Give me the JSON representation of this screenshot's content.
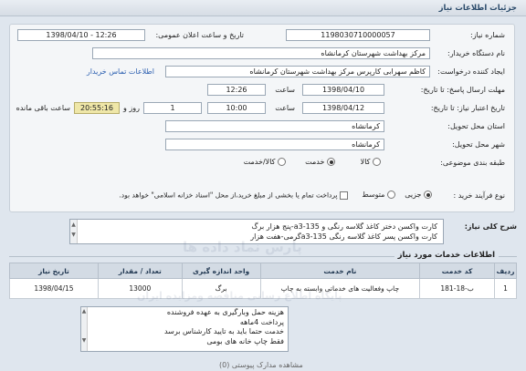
{
  "header": {
    "title": "جزئیات اطلاعات نیاز"
  },
  "form": {
    "need_number_label": "شماره نیاز:",
    "need_number": "1198030710000057",
    "announce_label": "تاریخ و ساعت اعلان عمومی:",
    "announce_value": "1398/04/10 - 12:26",
    "buyer_org_label": "نام دستگاه خریدار:",
    "buyer_org": "مرکز بهداشت شهرستان کرمانشاه",
    "creator_label": "ایجاد کننده درخواست:",
    "creator": "کاظم  سهرابی کارپرس مرکز بهداشت شهرستان کرمانشاه",
    "contact_link": "اطلاعات تماس خریدار",
    "deadline_label": "مهلت ارسال پاسخ: تا تاریخ:",
    "deadline_date": "1398/04/10",
    "deadline_time_label": "ساعت",
    "deadline_time": "12:26",
    "validity_label": "تاریخ اعتبار نیاز: تا تاریخ:",
    "validity_date": "1398/04/12",
    "validity_time_label": "ساعت",
    "validity_time": "10:00",
    "days_value": "1",
    "days_label": "روز و",
    "timer_value": "20:55:16",
    "remaining_label": "ساعت باقی مانده",
    "province_label": "استان محل تحویل:",
    "province": "کرمانشاه",
    "city_label": "شهر محل تحویل:",
    "city": "کرمانشاه",
    "category_label": "طبقه بندی موضوعی:",
    "category_options": [
      "کالا",
      "خدمت",
      "کالا/خدمت"
    ],
    "category_selected": "خدمت",
    "process_label": "نوع فرآیند خرید :",
    "process_options": [
      "جزیی",
      "متوسط"
    ],
    "process_selected": "جزیی",
    "payment_note": "پرداخت تمام یا بخشی از مبلغ خرید،از محل \"اسناد خزانه اسلامی\" خواهد بود."
  },
  "description": {
    "label": "شرح کلی نیاز:",
    "lines": [
      "کارت واکسن دختر کاغذ گلاسه  رنگی و 135-a3-پنج هزار برگ",
      "کارت واکسن پسر کاغذ گلاسه  رنگی a3-135گرمی-هفت هزار"
    ]
  },
  "services": {
    "section_title": "اطلاعات خدمات مورد نیاز",
    "columns": [
      "ردیف",
      "کد خدمت",
      "نام خدمت",
      "واحد اندازه گیری",
      "تعداد / مقدار",
      "تاریخ نیاز"
    ],
    "rows": [
      {
        "row": "1",
        "code": "ب-18-181",
        "name": "چاپ وفعالیت های خدماتی وابسته به چاپ",
        "unit": "برگ",
        "qty": "13000",
        "date": "1398/04/15"
      }
    ]
  },
  "notes": {
    "lines": [
      "هزینه حمل وبارگیری به عهده فروشنده",
      "پرداخت 4ماهه",
      "خدمت حتما باید به تایید کارشناس برسد",
      "فقط چاپ خانه های بومی"
    ]
  },
  "footer": {
    "partial_text": "مشاهده مدارک پیوستی (0)"
  },
  "watermark": {
    "title": "پارس نماد داده ها",
    "subtitle": "پایگاه اطلاع رسانی مناقصه ومزایده ایران"
  },
  "colors": {
    "background": "#dfe6ee",
    "panel": "#f4f6f8",
    "timer_bg": "#efe7a8",
    "link": "#2b5fb0",
    "table_header": "#d3dbe4"
  }
}
